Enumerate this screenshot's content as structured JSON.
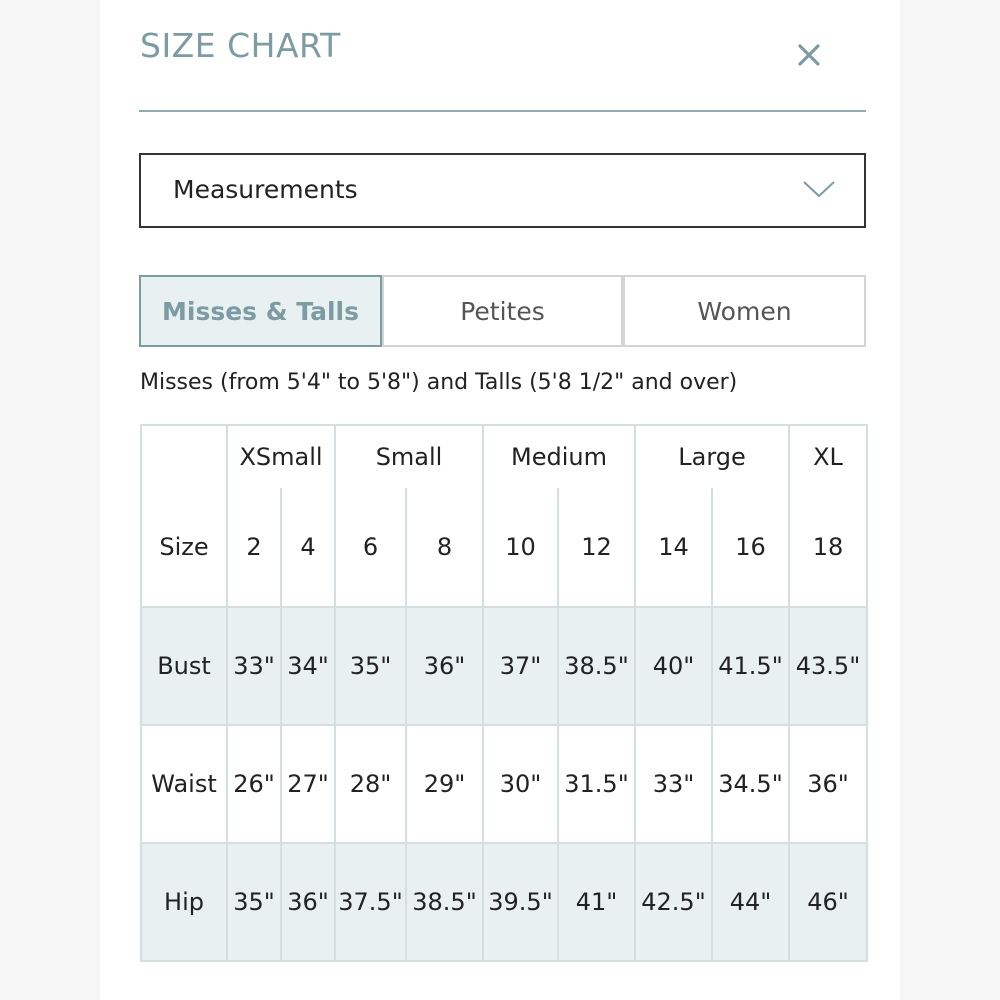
{
  "header": {
    "title": "SIZE CHART",
    "close_icon": "close-icon"
  },
  "dropdown": {
    "selected": "Measurements",
    "icon": "chevron-down-icon"
  },
  "tabs": [
    {
      "label": "Misses & Talls",
      "active": true
    },
    {
      "label": "Petites",
      "active": false
    },
    {
      "label": "Women",
      "active": false
    }
  ],
  "subtitle": "Misses (from 5'4\" to 5'8\") and Talls (5'8 1/2\" and over)",
  "table": {
    "size_label": "Size",
    "groups": [
      "XSmall",
      "Small",
      "Medium",
      "Large",
      "XL"
    ],
    "sizes": [
      "2",
      "4",
      "6",
      "8",
      "10",
      "12",
      "14",
      "16",
      "18"
    ],
    "rows": [
      {
        "label": "Bust",
        "values": [
          "33\"",
          "34\"",
          "35\"",
          "36\"",
          "37\"",
          "38.5\"",
          "40\"",
          "41.5\"",
          "43.5\""
        ]
      },
      {
        "label": "Waist",
        "values": [
          "26\"",
          "27\"",
          "28\"",
          "29\"",
          "30\"",
          "31.5\"",
          "33\"",
          "34.5\"",
          "36\""
        ]
      },
      {
        "label": "Hip",
        "values": [
          "35\"",
          "36\"",
          "37.5\"",
          "38.5\"",
          "39.5\"",
          "41\"",
          "42.5\"",
          "44\"",
          "46\""
        ]
      }
    ]
  },
  "colors": {
    "accent": "#7c9ba2",
    "shade": "#e8f0f2",
    "grid": "#d5dfe0"
  }
}
